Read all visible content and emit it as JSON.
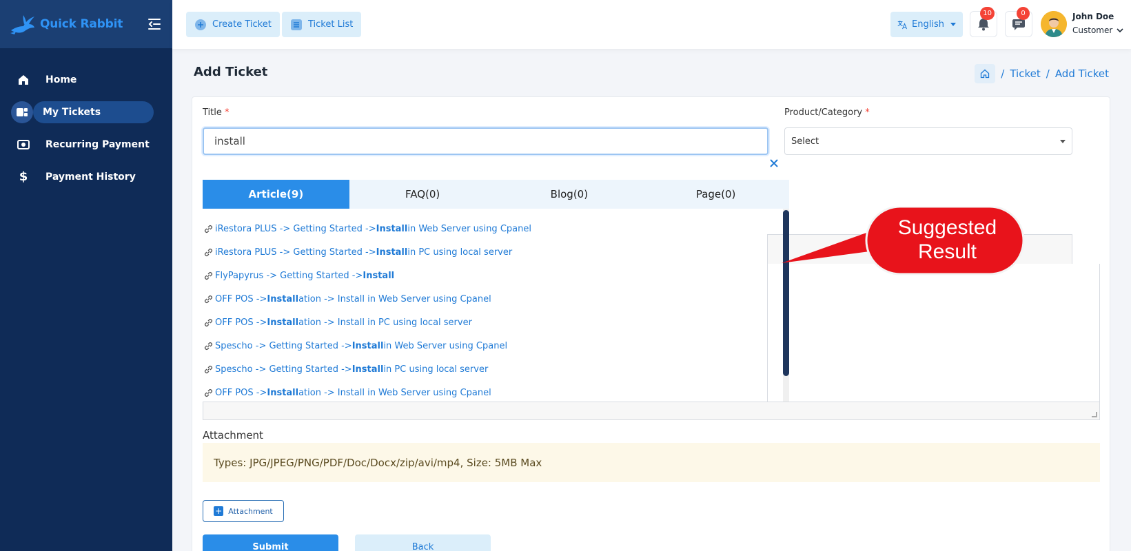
{
  "app": {
    "name": "Quick Rabbit"
  },
  "sidebar": {
    "items": [
      {
        "label": "Home",
        "icon": "home-icon"
      },
      {
        "label": "My Tickets",
        "icon": "tickets-icon",
        "active": true
      },
      {
        "label": "Recurring Payment",
        "icon": "money-icon"
      },
      {
        "label": "Payment History",
        "icon": "dollar-icon"
      }
    ]
  },
  "topbar": {
    "create_ticket": "Create Ticket",
    "ticket_list": "Ticket List",
    "language": "English",
    "notifications_count": "10",
    "messages_count": "0",
    "user_name": "John Doe",
    "user_role": "Customer"
  },
  "page": {
    "title": "Add Ticket",
    "breadcrumb": [
      "Ticket",
      "Add Ticket"
    ]
  },
  "form": {
    "title_label": "Title",
    "title_value": "install",
    "product_label": "Product/Category",
    "product_value": "Select",
    "required_mark": "*"
  },
  "suggestions": {
    "tabs": [
      "Article(9)",
      "FAQ(0)",
      "Blog(0)",
      "Page(0)"
    ],
    "items": [
      {
        "pre": "iRestora PLUS -> Getting Started -> ",
        "match": "Install",
        "post": " in Web Server using Cpanel"
      },
      {
        "pre": "iRestora PLUS -> Getting Started -> ",
        "match": "Install",
        "post": " in PC using local server"
      },
      {
        "pre": "FlyPapyrus -> Getting Started -> ",
        "match": "Install",
        "post": ""
      },
      {
        "pre": "OFF POS -> ",
        "match": "Install",
        "post": "ation -> Install in Web Server using Cpanel"
      },
      {
        "pre": "OFF POS -> ",
        "match": "Install",
        "post": "ation -> Install in PC using local server"
      },
      {
        "pre": "Spescho -> Getting Started -> ",
        "match": "Install",
        "post": " in Web Server using Cpanel"
      },
      {
        "pre": "Spescho -> Getting Started -> ",
        "match": "Install",
        "post": " in PC using local server"
      },
      {
        "pre": "OFF POS -> ",
        "match": "Install",
        "post": "ation -> Install in Web Server using Cpanel"
      }
    ]
  },
  "attachment": {
    "label": "Attachment",
    "types_text": "Types: JPG/JPEG/PNG/PDF/Doc/Docx/zip/avi/mp4, Size: 5MB Max",
    "button_label": "Attachment"
  },
  "actions": {
    "submit": "Submit",
    "back": "Back"
  },
  "callout": {
    "line1": "Suggested",
    "line2": "Result"
  },
  "colors": {
    "sidebar": "#0f2b57",
    "accent": "#2a8de8",
    "callout": "#e8131b",
    "badge": "#f44336"
  }
}
